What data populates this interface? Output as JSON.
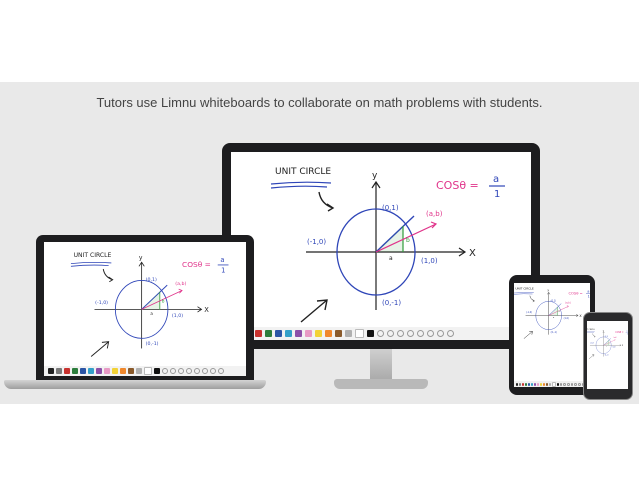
{
  "caption": "Tutors use Limnu whiteboards to collaborate on math problems with students.",
  "whiteboard": {
    "title": "UNIT CIRCLE",
    "formula_lhs": "COSθ =",
    "formula_num": "a",
    "formula_den": "1",
    "axis_y": "y",
    "axis_x": "X",
    "pt_top": "(0,1)",
    "pt_bottom": "(0,-1)",
    "pt_left": "(-1,0)",
    "pt_right": "(1,0)",
    "pt_ab": "(a,b)",
    "label_a": "a",
    "label_b": "b"
  },
  "toolbar_colors": [
    "#222222",
    "#7a7a7a",
    "#c8322f",
    "#2d7d3c",
    "#2b55a6",
    "#34a0c9",
    "#8c4fa8",
    "#e89ac5",
    "#f2d236",
    "#f0882c",
    "#8a5a2b",
    "#b0b0b0",
    "#ffffff",
    "#111111"
  ],
  "icons": {
    "tools": [
      "pen-icon",
      "eraser-icon",
      "select-icon",
      "text-icon",
      "shape-icon",
      "zoom-icon",
      "undo-icon",
      "redo-icon"
    ]
  }
}
